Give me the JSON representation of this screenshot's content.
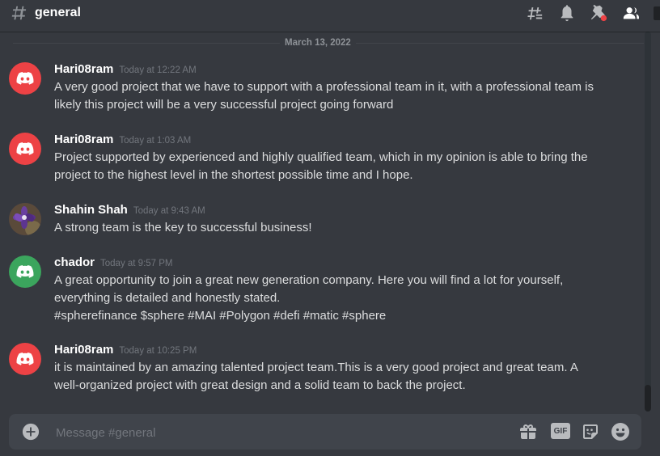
{
  "header": {
    "channel_name": "general",
    "icons": [
      "hashtag-icon",
      "threads-icon",
      "notification-bell-icon",
      "pinned-messages-icon",
      "member-list-icon"
    ]
  },
  "messages_panel": {
    "date_divider": "March 13, 2022",
    "messages": [
      {
        "author": "Hari08ram",
        "timestamp": "Today at 12:22 AM",
        "avatar": "discord-logo-avatar",
        "avatar_color": "#ed4245",
        "lines": [
          "A very good project that we have to support with a professional team in it, with a professional team is",
          "likely this project will be a very successful project going forward"
        ]
      },
      {
        "author": "Hari08ram",
        "timestamp": "Today at 1:03 AM",
        "avatar": "discord-logo-avatar",
        "avatar_color": "#ed4245",
        "lines": [
          "Project supported by experienced and highly qualified team, which in my opinion is able to bring the",
          "project to the highest level in the shortest possible time and I hope."
        ]
      },
      {
        "author": "Shahin Shah",
        "timestamp": "Today at 9:43 AM",
        "avatar": "flower-photo-avatar",
        "avatar_color": "#4a3a55",
        "lines": [
          "A strong team is the key to successful business!"
        ]
      },
      {
        "author": "chador",
        "timestamp": "Today at 9:57 PM",
        "avatar": "discord-logo-avatar",
        "avatar_color": "#3ba55d",
        "lines": [
          "A great opportunity to join a great new generation company. Here you will find a lot for yourself,",
          "everything is detailed and honestly stated.",
          "#spherefinance $sphere #MAI #Polygon #defi #matic #sphere"
        ]
      },
      {
        "author": "Hari08ram",
        "timestamp": "Today at 10:25 PM",
        "avatar": "discord-logo-avatar",
        "avatar_color": "#ed4245",
        "lines": [
          "it is maintained by an amazing talented project team.This is a very good project and great team. A",
          "well-organized project with great design and a solid team to back the project."
        ]
      }
    ]
  },
  "composer": {
    "placeholder": "Message #general",
    "value": "",
    "gif_label": "GIF",
    "icons": [
      "add-attachment-icon",
      "gift-icon",
      "gif-icon",
      "sticker-icon",
      "emoji-icon"
    ]
  },
  "colors": {
    "background": "#36393f",
    "composer_bg": "#40444b",
    "text": "#dcddde",
    "muted": "#72767d",
    "red_avatar": "#ed4245",
    "green_avatar": "#3ba55d"
  }
}
